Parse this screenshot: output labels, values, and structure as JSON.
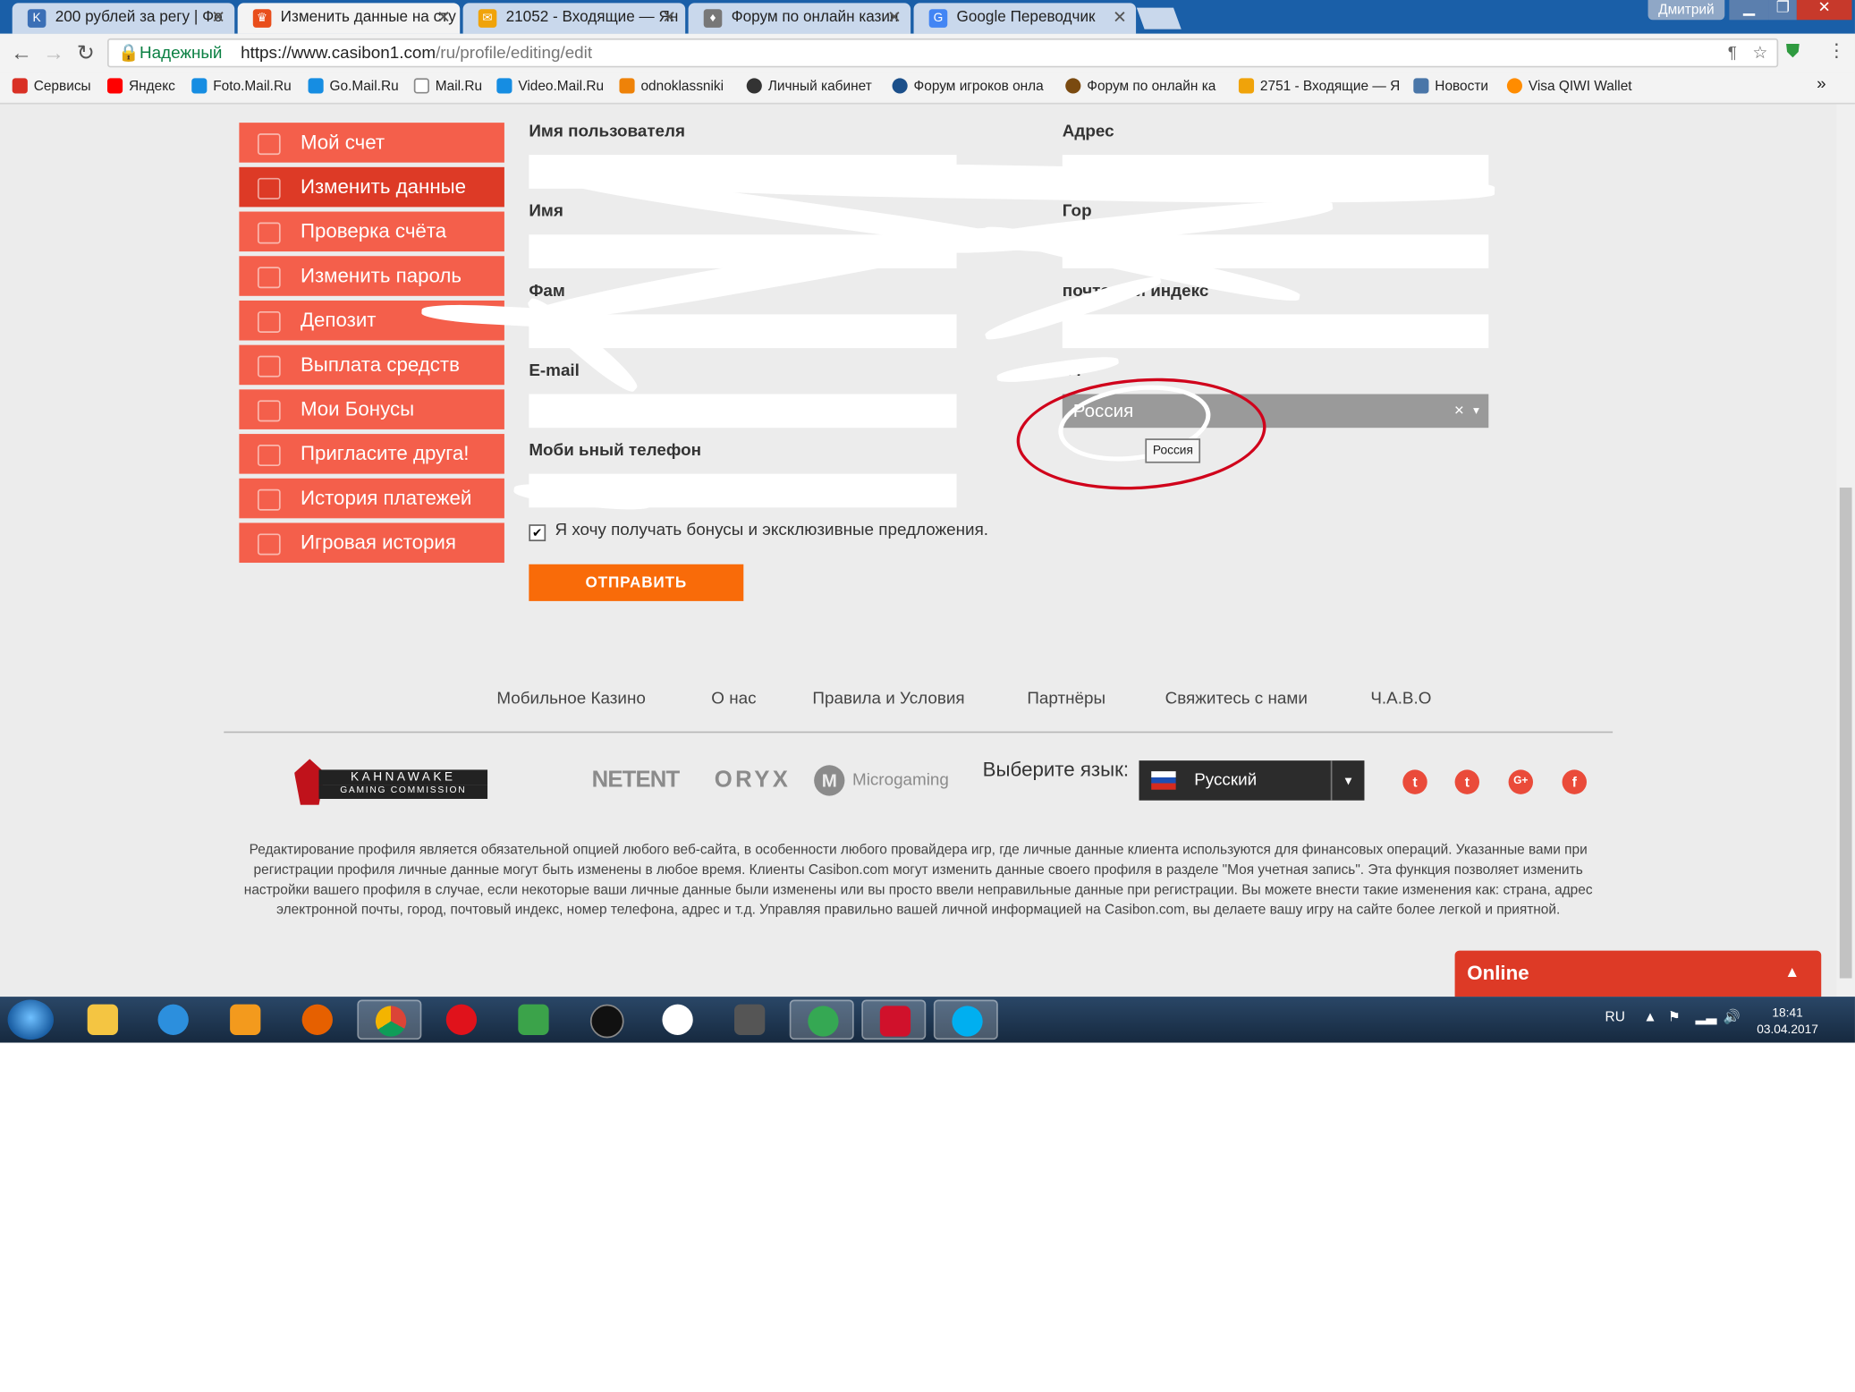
{
  "browser": {
    "tabs": [
      {
        "title": "200 рублей за регу | Фо",
        "favicon_color": "#3b6fb6",
        "active": false
      },
      {
        "title": "Изменить данные на сту",
        "favicon_color": "#e94e1b",
        "active": true
      },
      {
        "title": "21052 - Входящие — Ян",
        "favicon_color": "#f0a30a",
        "active": false
      },
      {
        "title": "Форум по онлайн казин",
        "favicon_color": "#777777",
        "active": false
      },
      {
        "title": "Google Переводчик",
        "favicon_color": "#4285f4",
        "active": false
      }
    ],
    "user_name": "Дмитрий",
    "secure_label": "Надежный",
    "url_host": "https://www.casibon1.com",
    "url_path": "/ru/profile/editing/edit",
    "bookmarks": [
      {
        "label": "Сервисы",
        "color": "#d93025"
      },
      {
        "label": "Яндекс",
        "color": "#ff0000"
      },
      {
        "label": "Foto.Mail.Ru",
        "color": "#168de2"
      },
      {
        "label": "Go.Mail.Ru",
        "color": "#168de2"
      },
      {
        "label": "Mail.Ru",
        "color": "#888888"
      },
      {
        "label": "Video.Mail.Ru",
        "color": "#168de2"
      },
      {
        "label": "odnoklassniki",
        "color": "#ee8208"
      },
      {
        "label": "Личный кабинет",
        "color": "#333333"
      },
      {
        "label": "Форум игроков онла",
        "color": "#1b4f8a"
      },
      {
        "label": "Форум по онлайн ка",
        "color": "#7a4a10"
      },
      {
        "label": "2751 - Входящие — Я",
        "color": "#f0a30a"
      },
      {
        "label": "Новости",
        "color": "#4a76a8"
      },
      {
        "label": "Visa QIWI Wallet",
        "color": "#ff8c00"
      }
    ]
  },
  "sidebar": {
    "items": [
      {
        "label": "Мой счет"
      },
      {
        "label": "Изменить данные"
      },
      {
        "label": "Проверка счёта"
      },
      {
        "label": "Изменить пароль"
      },
      {
        "label": "Депозит"
      },
      {
        "label": "Выплата средств"
      },
      {
        "label": "Мои Бонусы"
      },
      {
        "label": "Пригласите друга!"
      },
      {
        "label": "История платежей"
      },
      {
        "label": "Игровая история"
      }
    ]
  },
  "form": {
    "username_label": "Имя пользователя",
    "firstname_label": "Имя",
    "lastname_label": "Фам",
    "email_label": "E-mail",
    "phone_label": "Моби   ьный телефон",
    "address_label": "Адрес",
    "city_label": "Гор",
    "zip_label": "почтовый индекс",
    "country_label": "Ст",
    "country_value": "Россия",
    "clear_glyph": "×",
    "tooltip": "Россия",
    "bonus_checkbox_label": "Я хочу получать бонусы и эксклюзивные предложения.",
    "bonus_checked": true,
    "submit_label": "ОТПРАВИТЬ"
  },
  "footer": {
    "links": [
      "Мобильное Казино",
      "О нас",
      "Правила и Условия",
      "Партнёры",
      "Свяжитесь с нами",
      "Ч.А.В.О"
    ],
    "logos": {
      "kahnawake_top": "KAHNAWAKE",
      "kahnawake_bottom": "GAMING COMMISSION",
      "netent": "NETENT",
      "oryx": "ORYX",
      "microgaming": "Microgaming"
    },
    "language_label": "Выберите язык:",
    "language_value": "Русский",
    "description": "Редактирование профиля является обязательной опцией любого веб-сайта, в особенности любого провайдера игр, где личные данные клиента используются для финансовых операций. Указанные вами при регистрации профиля личные данные могут быть изменены в любое время. Клиенты Casibon.com могут изменить данные своего профиля в разделе \"Моя учетная запись\". Эта функция позволяет изменить настройки вашего профиля в случае, если некоторые ваши личные данные были изменены или вы просто ввели неправильные данные при регистрации. Вы можете внести такие изменения как: страна, адрес электронной почты, город, почтовый индекс, номер телефона, адрес и т.д. Управляя правильно вашей личной информацией на Casibon.com, вы делаете вашу игру на сайте более легкой и приятной."
  },
  "chat": {
    "label": "Online"
  },
  "taskbar": {
    "language": "RU",
    "time": "18:41",
    "date": "03.04.2017"
  }
}
